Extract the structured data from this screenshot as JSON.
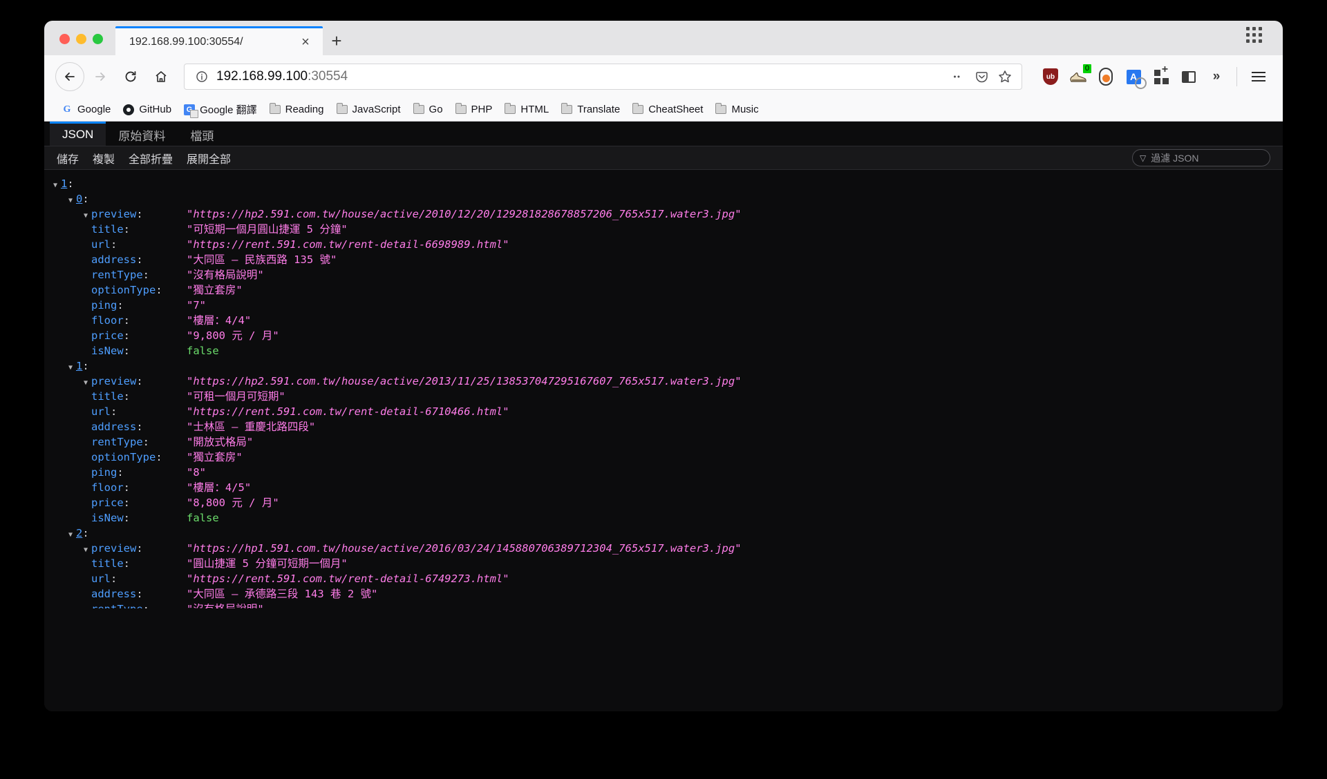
{
  "window": {
    "traffic_lights": [
      "close",
      "minimize",
      "maximize"
    ],
    "tab_title": "192.168.99.100:30554/",
    "tab_close_glyph": "×",
    "new_tab_glyph": "+",
    "app_grid_label": "app-grid"
  },
  "nav": {
    "back_glyph": "←",
    "forward_glyph": "→",
    "reload_glyph": "⟳",
    "home_glyph": "⌂",
    "url_host": "192.168.99.100",
    "url_port": ":30554",
    "info_glyph": "ⓘ",
    "more_glyph": "•••",
    "pocket_glyph": "✓",
    "star_glyph": "☆",
    "ublock_label": "ub",
    "badge_count": "0",
    "translate_letter": "A",
    "chevron_glyph": "»",
    "menu_label": "menu"
  },
  "bookmarks": [
    {
      "label": "Google",
      "icon": "google-icon"
    },
    {
      "label": "GitHub",
      "icon": "github-icon"
    },
    {
      "label": "Google 翻譯",
      "icon": "google-translate-icon"
    },
    {
      "label": "Reading",
      "icon": "folder-icon"
    },
    {
      "label": "JavaScript",
      "icon": "folder-icon"
    },
    {
      "label": "Go",
      "icon": "folder-icon"
    },
    {
      "label": "PHP",
      "icon": "folder-icon"
    },
    {
      "label": "HTML",
      "icon": "folder-icon"
    },
    {
      "label": "Translate",
      "icon": "folder-icon"
    },
    {
      "label": "CheatSheet",
      "icon": "folder-icon"
    },
    {
      "label": "Music",
      "icon": "folder-icon"
    }
  ],
  "json_viewer": {
    "tabs": [
      {
        "label": "JSON",
        "active": true
      },
      {
        "label": "原始資料",
        "active": false
      },
      {
        "label": "檔頭",
        "active": false
      }
    ],
    "toolbar": [
      {
        "label": "儲存"
      },
      {
        "label": "複製"
      },
      {
        "label": "全部折疊"
      },
      {
        "label": "展開全部"
      }
    ],
    "filter_placeholder": "過濾 JSON",
    "funnel_glyph": "▽",
    "twisty_open": "▼",
    "root_key": "1",
    "colors": {
      "key": "#4e9eff",
      "string": "#ff7de9",
      "boolean": "#6bdc6b",
      "background": "#0c0c0d",
      "accent": "#0a84ff"
    },
    "keys": {
      "preview": "preview",
      "title": "title",
      "url": "url",
      "address": "address",
      "rentType": "rentType",
      "optionType": "optionType",
      "ping": "ping",
      "floor": "floor",
      "price": "price",
      "isNew": "isNew"
    },
    "items": [
      {
        "index": "0",
        "preview": "\"https://hp2.591.com.tw/house/active/2010/12/20/129281828678857206_765x517.water3.jpg\"",
        "title": "\"可短期一個月圓山捷運 5 分鐘\"",
        "url": "\"https://rent.591.com.tw/rent-detail-6698989.html\"",
        "address": "\"大同區 – 民族西路 135 號\"",
        "rentType": "\"沒有格局說明\"",
        "optionType": "\"獨立套房\"",
        "ping": "\"7\"",
        "floor": "\"樓層：4/4\"",
        "price": "\"9,800 元 / 月\"",
        "isNew": "false"
      },
      {
        "index": "1",
        "preview": "\"https://hp2.591.com.tw/house/active/2013/11/25/138537047295167607_765x517.water3.jpg\"",
        "title": "\"可租一個月可短期\"",
        "url": "\"https://rent.591.com.tw/rent-detail-6710466.html\"",
        "address": "\"士林區 – 重慶北路四段\"",
        "rentType": "\"開放式格局\"",
        "optionType": "\"獨立套房\"",
        "ping": "\"8\"",
        "floor": "\"樓層：4/5\"",
        "price": "\"8,800 元 / 月\"",
        "isNew": "false"
      },
      {
        "index": "2",
        "preview": "\"https://hp1.591.com.tw/house/active/2016/03/24/145880706389712304_765x517.water3.jpg\"",
        "title": "\"圓山捷運 5 分鐘可短期一個月\"",
        "url": "\"https://rent.591.com.tw/rent-detail-6749273.html\"",
        "address": "\"大同區 – 承德路三段 143 巷 2 號\"",
        "rentType": "\"沒有格局說明\"",
        "optionType": "",
        "ping": "",
        "floor": "",
        "price": "",
        "isNew": ""
      }
    ]
  }
}
